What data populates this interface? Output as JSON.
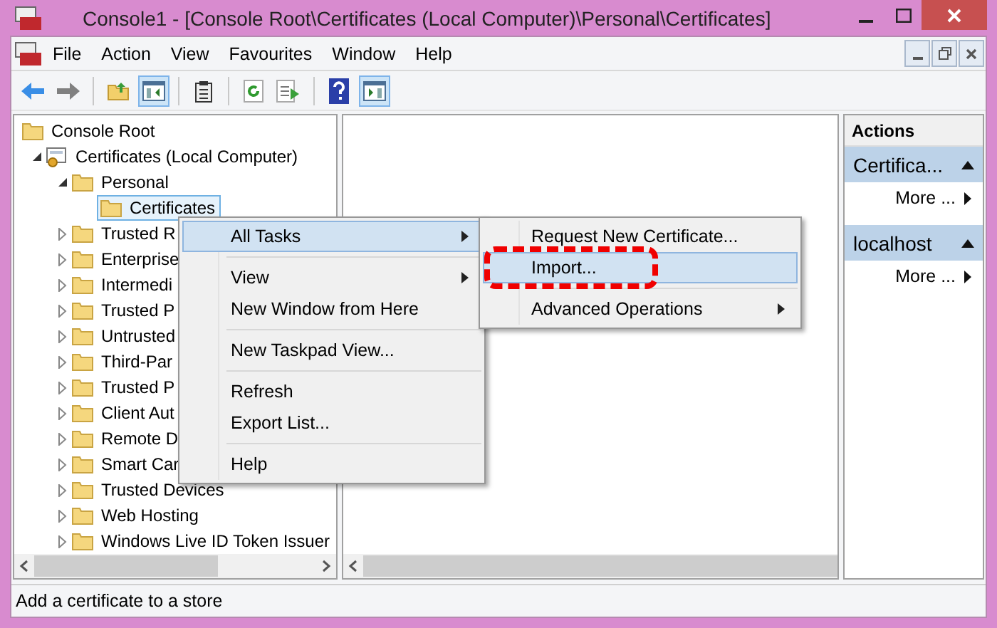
{
  "window": {
    "title": "Console1 - [Console Root\\Certificates (Local Computer)\\Personal\\Certificates]"
  },
  "menu_bar": [
    "File",
    "Action",
    "View",
    "Favourites",
    "Window",
    "Help"
  ],
  "tree": [
    {
      "label": "Console Root",
      "kind": "folder",
      "selected": false,
      "children": [
        {
          "label": "Certificates (Local Computer)",
          "kind": "certificate",
          "expanded": true,
          "selected": false,
          "children": [
            {
              "label": "Personal",
              "kind": "folder",
              "expanded": true,
              "selected": false,
              "children": [
                {
                  "label": "Certificates",
                  "kind": "folder",
                  "selected": true
                }
              ]
            },
            {
              "label": "Trusted R",
              "kind": "folder",
              "expanded": false,
              "selected": false
            },
            {
              "label": "Enterprise",
              "kind": "folder",
              "expanded": false,
              "selected": false
            },
            {
              "label": "Intermedi",
              "kind": "folder",
              "expanded": false,
              "selected": false
            },
            {
              "label": "Trusted P",
              "kind": "folder",
              "expanded": false,
              "selected": false
            },
            {
              "label": "Untrusted",
              "kind": "folder",
              "expanded": false,
              "selected": false
            },
            {
              "label": "Third-Par",
              "kind": "folder",
              "expanded": false,
              "selected": false
            },
            {
              "label": "Trusted P",
              "kind": "folder",
              "expanded": false,
              "selected": false
            },
            {
              "label": "Client Aut",
              "kind": "folder",
              "expanded": false,
              "selected": false
            },
            {
              "label": "Remote D",
              "kind": "folder",
              "expanded": false,
              "selected": false
            },
            {
              "label": "Smart Car",
              "kind": "folder",
              "expanded": false,
              "selected": false
            },
            {
              "label": "Trusted Devices",
              "kind": "folder",
              "expanded": false,
              "selected": false
            },
            {
              "label": "Web Hosting",
              "kind": "folder",
              "expanded": false,
              "selected": false
            },
            {
              "label": "Windows Live ID Token Issuer",
              "kind": "folder",
              "expanded": false,
              "selected": false
            }
          ]
        }
      ]
    }
  ],
  "actions_pane": {
    "title": "Actions",
    "sections": [
      {
        "title": "Certifica...",
        "items": [
          "More ..."
        ]
      },
      {
        "title": "localhost",
        "items": [
          "More ..."
        ]
      }
    ]
  },
  "context_menu": [
    {
      "kind": "item",
      "label": "All Tasks",
      "has_submenu": true,
      "selected": true
    },
    {
      "kind": "separator"
    },
    {
      "kind": "item",
      "label": "View",
      "has_submenu": true,
      "selected": false
    },
    {
      "kind": "item",
      "label": "New Window from Here",
      "has_submenu": false,
      "selected": false
    },
    {
      "kind": "separator"
    },
    {
      "kind": "item",
      "label": "New Taskpad View...",
      "has_submenu": false,
      "selected": false
    },
    {
      "kind": "separator"
    },
    {
      "kind": "item",
      "label": "Refresh",
      "has_submenu": false,
      "selected": false
    },
    {
      "kind": "item",
      "label": "Export List...",
      "has_submenu": false,
      "selected": false
    },
    {
      "kind": "separator"
    },
    {
      "kind": "item",
      "label": "Help",
      "has_submenu": false,
      "selected": false
    }
  ],
  "submenu": [
    {
      "kind": "item",
      "label": "Request New Certificate...",
      "has_submenu": false,
      "selected": false,
      "annotated": false
    },
    {
      "kind": "item",
      "label": "Import...",
      "has_submenu": false,
      "selected": true,
      "annotated": true
    },
    {
      "kind": "separator"
    },
    {
      "kind": "item",
      "label": "Advanced Operations",
      "has_submenu": true,
      "selected": false,
      "annotated": false
    }
  ],
  "status_bar": "Add a certificate to a store"
}
